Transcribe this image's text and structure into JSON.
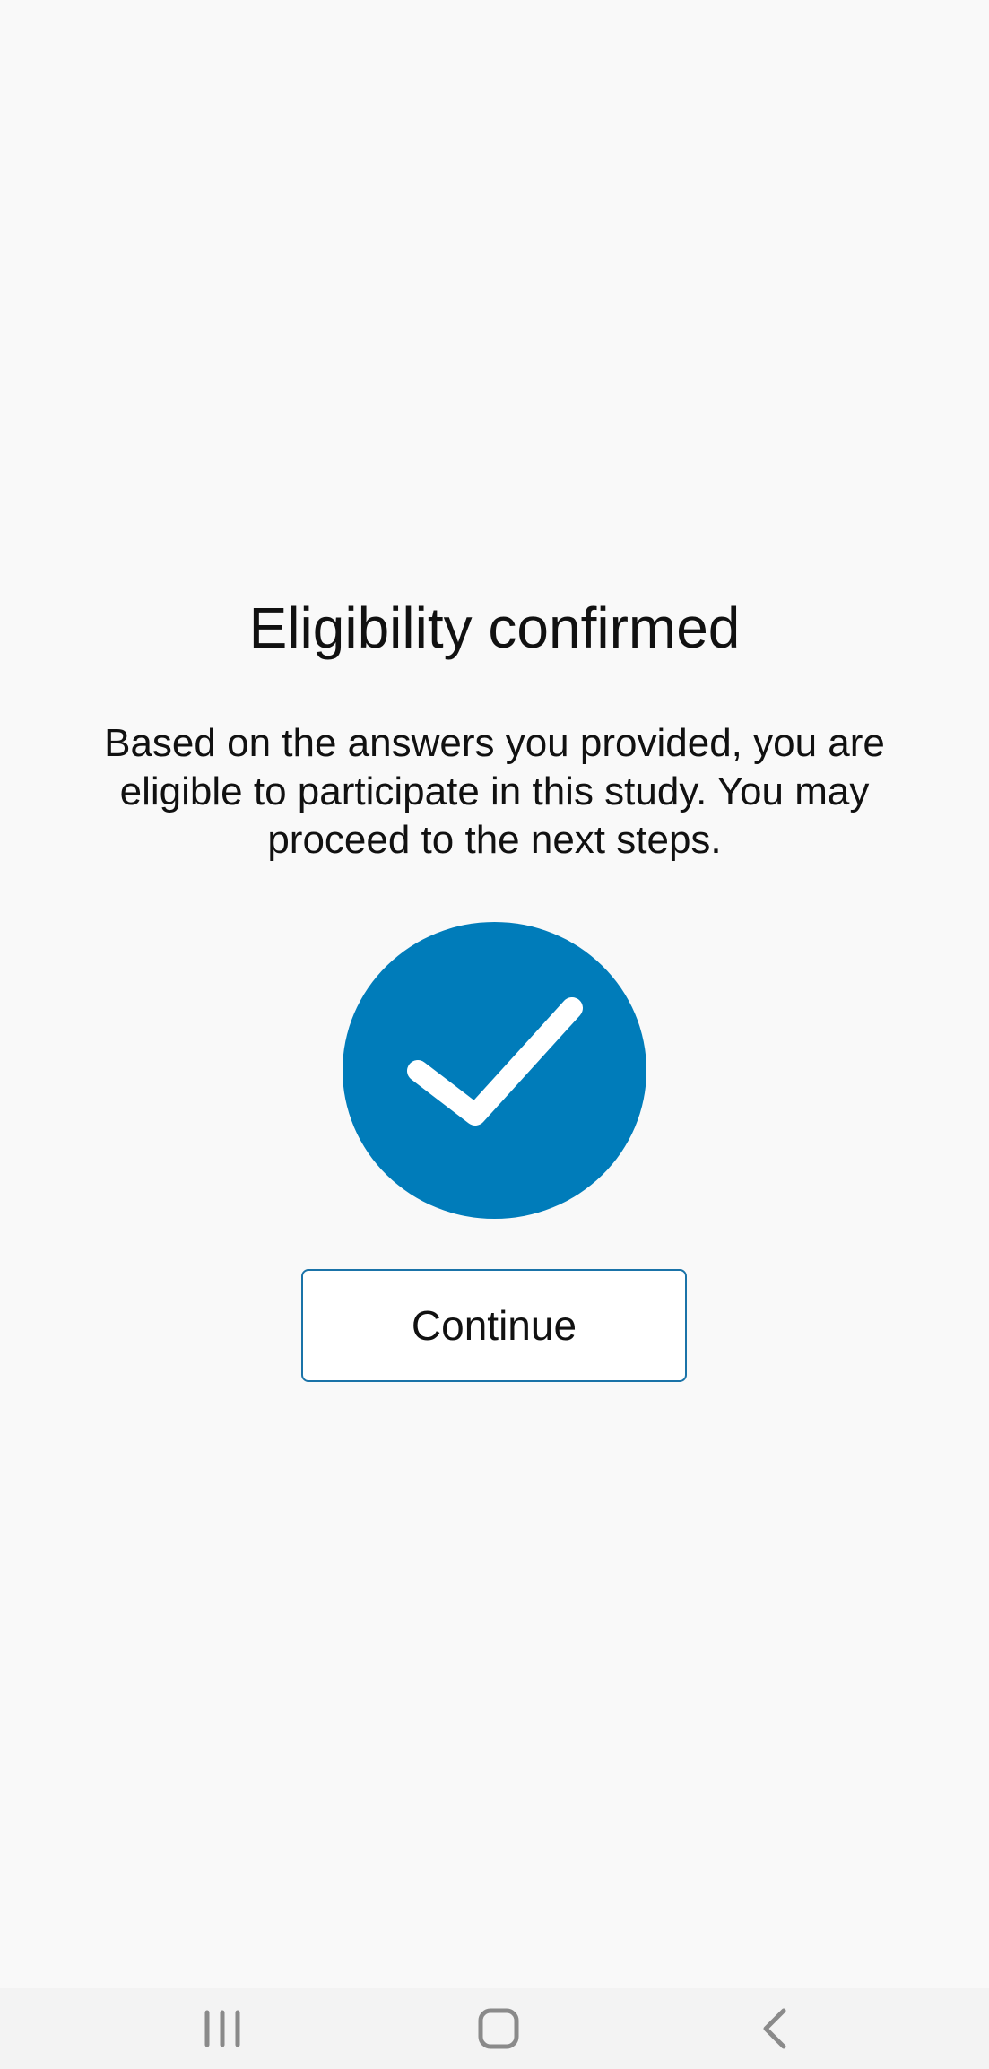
{
  "screen": {
    "title": "Eligibility confirmed",
    "message": "Based on the answers you provided, you are eligible to participate in this study. You may proceed to the next steps.",
    "status_icon": "checkmark-circle-icon",
    "continue_label": "Continue"
  },
  "navbar": {
    "recents_icon": "recent-apps-icon",
    "home_icon": "home-icon",
    "back_icon": "back-icon"
  },
  "colors": {
    "background": "#f9f9f9",
    "accent": "#007cba",
    "button_border": "#1a73a8",
    "navbar_background": "#f3f3f3",
    "nav_icon": "#8a8a8a"
  }
}
